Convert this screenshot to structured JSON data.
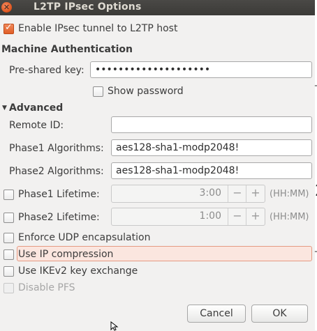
{
  "window": {
    "title": "L2TP IPsec Options"
  },
  "enable": {
    "label": "Enable IPsec tunnel to L2TP host",
    "checked": true
  },
  "machine_auth": {
    "heading": "Machine Authentication",
    "psk_label": "Pre-shared key:",
    "psk_value": "••••••••••••••••••••",
    "show_password_label": "Show password"
  },
  "advanced": {
    "heading": "Advanced",
    "remote_id_label": "Remote ID:",
    "remote_id_value": "",
    "phase1_alg_label": "Phase1 Algorithms:",
    "phase1_alg_value": "aes128-sha1-modp2048!",
    "phase2_alg_label": "Phase2 Algorithms:",
    "phase2_alg_value": "aes128-sha1-modp2048!",
    "phase1_lifetime_label": "Phase1 Lifetime:",
    "phase1_lifetime_value": "3:00",
    "phase2_lifetime_label": "Phase2 Lifetime:",
    "phase2_lifetime_value": "1:00",
    "unit": "(HH:MM)",
    "minus": "−",
    "plus": "+"
  },
  "options": {
    "udp_encap": "Enforce UDP encapsulation",
    "ip_compression": "Use IP compression",
    "ikev2": "Use IKEv2 key exchange",
    "disable_pfs": "Disable PFS"
  },
  "buttons": {
    "cancel": "Cancel",
    "ok": "OK"
  },
  "icons": {
    "close": "close-icon",
    "expander": "expander-down-icon",
    "check": "check-icon"
  },
  "colors": {
    "accent": "#e05d25",
    "titlebar": "#3c3b37",
    "highlight": "#fbe6df"
  }
}
